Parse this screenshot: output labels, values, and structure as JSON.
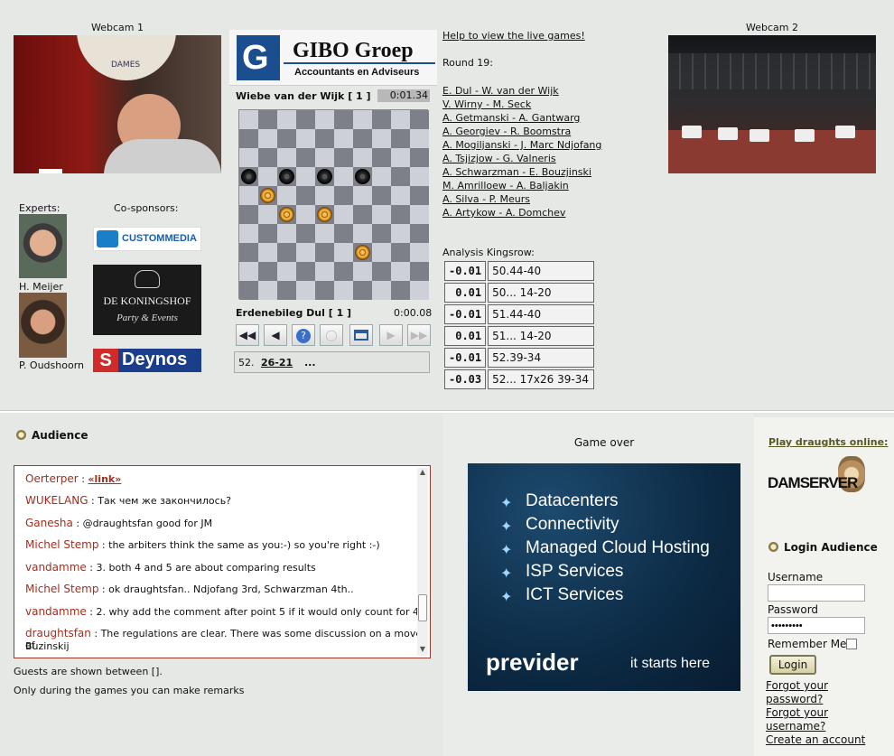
{
  "webcam1": {
    "label": "Webcam 1",
    "banner_text": "DAMES"
  },
  "webcam2": {
    "label": "Webcam 2"
  },
  "sponsor_main": {
    "name": "GIBO Groep",
    "tagline": "Accountants en Adviseurs"
  },
  "help_link": "Help to view the live games!",
  "round_label": "Round 19:",
  "games": [
    "E. Dul - W. van der Wijk",
    "V. Wirny - M. Seck",
    "A. Getmanski - A. Gantwarg",
    "A. Georgiev - R. Boomstra",
    "A. Mogiljanski - J. Marc Ndjofang",
    "A. Tsjizjow - G. Valneris",
    "A. Schwarzman - E. Bouzjinski",
    "M. Amrilloew - A. Baljakin",
    "A. Silva - P. Meurs",
    "A. Artykow - A. Domchev"
  ],
  "board": {
    "top_player": "Wiebe van der Wijk [ 1 ]",
    "top_clock": "0:01.34",
    "bottom_player": "Erdenebileg Dul [ 1 ]",
    "bottom_clock": "0:00.08",
    "move_number": "52.",
    "move_link": "26-21",
    "move_more": "..."
  },
  "analysis": {
    "title": "Analysis Kingsrow:",
    "rows": [
      {
        "score": "-0.01",
        "move": "50.44-40"
      },
      {
        "score": "0.01",
        "move": "50... 14-20"
      },
      {
        "score": "-0.01",
        "move": "51.44-40"
      },
      {
        "score": "0.01",
        "move": "51... 14-20"
      },
      {
        "score": "-0.01",
        "move": "52.39-34"
      },
      {
        "score": "-0.03",
        "move": "52... 17x26 39-34"
      }
    ]
  },
  "experts": {
    "label": "Experts:",
    "names": [
      "H. Meijer",
      "P. Oudshoorn"
    ]
  },
  "cosponsors": {
    "label": "Co-sponsors:",
    "logos": [
      "CUSTOMMEDIA",
      "DE KONINGSHOF",
      "Party & Events",
      "Deynos"
    ]
  },
  "audience": {
    "title": "Audience",
    "messages": [
      {
        "user": "Oerterper",
        "text": "«link»"
      },
      {
        "user": "WUKELANG",
        "text": "Так чем же закончилось?"
      },
      {
        "user": "Ganesha",
        "text": "@draughtsfan good for JM"
      },
      {
        "user": "Michel Stemp",
        "text": "the arbiters think the same as you:-) so you're right :-)"
      },
      {
        "user": "vandamme",
        "text": "3. both 4 and 5 are about comparing results"
      },
      {
        "user": "Michel Stemp",
        "text": "ok draughtsfan.. Ndjofang 3rd, Schwarzman 4th.."
      },
      {
        "user": "vandamme",
        "text": "2. why add the comment after point 5 if it would only count for 4"
      },
      {
        "user": "draughtsfan",
        "text": "The regulations are clear. There was some discussion on a move of"
      },
      {
        "user": "",
        "text": "Buzinskij"
      }
    ],
    "note1": "Guests are shown between [].",
    "note2": "Only during the games you can make remarks"
  },
  "game_status": "Game over",
  "ad": {
    "items": [
      "Datacenters",
      "Connectivity",
      "Managed Cloud Hosting",
      "ISP Services",
      "ICT Services"
    ],
    "brand": "previder",
    "slogan": "it starts here"
  },
  "right": {
    "play_link": "Play draughts online:",
    "damserver_logo": "DAMSERVER",
    "login_title": "Login Audience",
    "username_label": "Username",
    "password_label": "Password",
    "password_value": "•••••••••",
    "remember_label": "Remember Me",
    "login_button": "Login",
    "forgot_password": "Forgot your password?",
    "forgot_username": "Forgot your username?",
    "create_account": "Create an account"
  }
}
